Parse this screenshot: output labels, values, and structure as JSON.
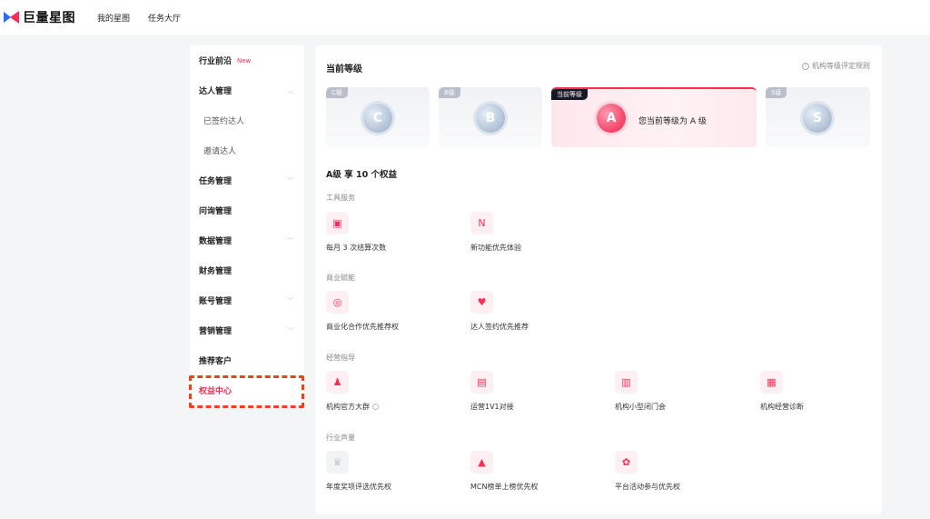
{
  "header": {
    "logo_text": "巨量星图",
    "nav": [
      "我的星图",
      "任务大厅"
    ]
  },
  "sidebar": {
    "items": [
      {
        "label": "行业前沿",
        "tag": "New"
      },
      {
        "label": "达人管理",
        "chevron": "^"
      },
      {
        "label": "已签约达人"
      },
      {
        "label": "邀请达人"
      },
      {
        "label": "任务管理",
        "chevron": "v"
      },
      {
        "label": "问询管理"
      },
      {
        "label": "数据管理",
        "chevron": "v"
      },
      {
        "label": "财务管理"
      },
      {
        "label": "账号管理",
        "chevron": "v"
      },
      {
        "label": "营销管理",
        "chevron": "v"
      },
      {
        "label": "推荐客户"
      },
      {
        "label": "权益中心"
      }
    ]
  },
  "main": {
    "title": "当前等级",
    "rules_link": "机构等级评定规则",
    "levels": [
      {
        "tag": "C级",
        "letter": "C"
      },
      {
        "tag": "B级",
        "letter": "B"
      },
      {
        "tag": "当前等级",
        "letter": "A",
        "text": "您当前等级为 A 级"
      },
      {
        "tag": "S级",
        "letter": "S"
      }
    ],
    "benefits_title": "A级 享 10 个权益",
    "sections": [
      {
        "label": "工具服务",
        "items": [
          {
            "label": "每月 3 次结算次数",
            "icon": "wallet-icon",
            "glyph": "▣"
          },
          {
            "label": "新功能优先体验",
            "icon": "new-feature-icon",
            "glyph": "N"
          }
        ]
      },
      {
        "label": "商业赋能",
        "items": [
          {
            "label": "商业化合作优先推荐权",
            "icon": "medal-icon",
            "glyph": "◎"
          },
          {
            "label": "达人签约优先推荐",
            "icon": "thumbs-up-icon",
            "glyph": "♥"
          }
        ]
      },
      {
        "label": "经营指导",
        "items": [
          {
            "label": "机构官方大群",
            "icon": "group-icon",
            "glyph": "♟"
          },
          {
            "label": "运营1V1对接",
            "icon": "chat-icon",
            "glyph": "▤"
          },
          {
            "label": "机构小型闭门会",
            "icon": "meeting-icon",
            "glyph": "▥"
          },
          {
            "label": "机构经营诊断",
            "icon": "analytics-icon",
            "glyph": "▦"
          }
        ]
      },
      {
        "label": "行业声量",
        "items": [
          {
            "label": "年度奖项评选优先权",
            "icon": "trophy-icon",
            "glyph": "♛"
          },
          {
            "label": "MCN榜单上榜优先权",
            "icon": "ranking-icon",
            "glyph": "▲"
          },
          {
            "label": "平台活动参与优先权",
            "icon": "activity-icon",
            "glyph": "✿"
          }
        ]
      }
    ]
  }
}
